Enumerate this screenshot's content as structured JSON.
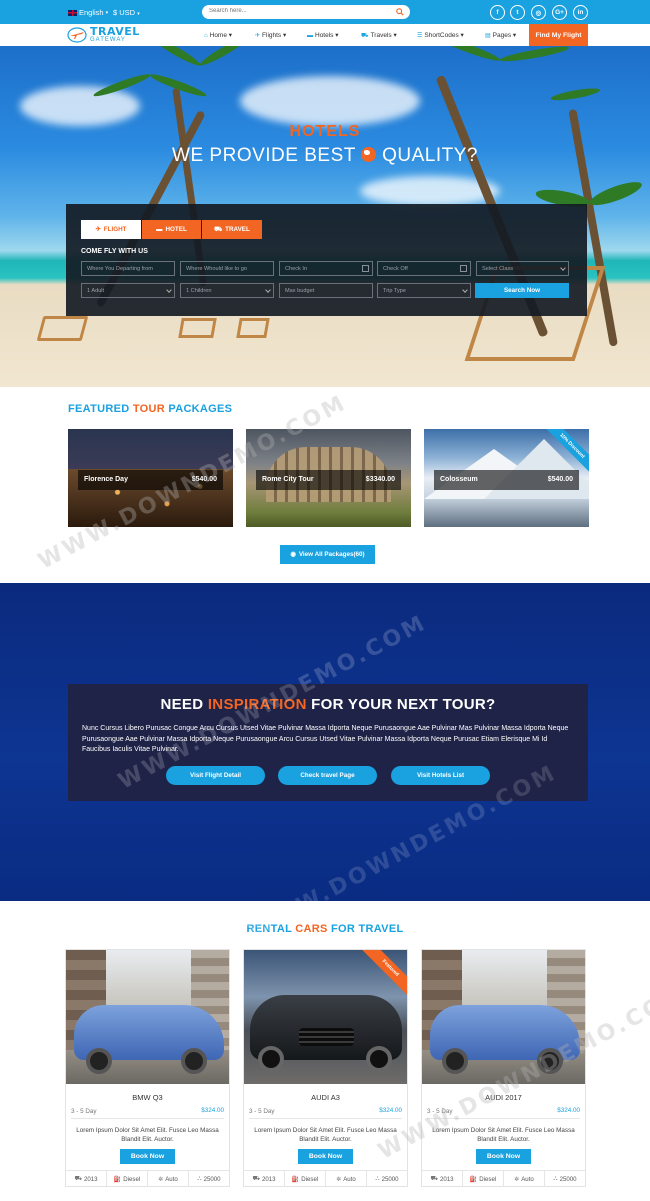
{
  "topbar": {
    "language": "English",
    "currency": "$ USD",
    "search_placeholder": "Search here...",
    "social": [
      "f",
      "t",
      "◎",
      "G+",
      "in"
    ]
  },
  "logo": {
    "line1": "TRAVEL",
    "line2": "GATEWAY"
  },
  "nav": {
    "items": [
      {
        "label": "Home",
        "icon": "home-icon"
      },
      {
        "label": "Flights",
        "icon": "plane-icon"
      },
      {
        "label": "Hotels",
        "icon": "bed-icon"
      },
      {
        "label": "Travels",
        "icon": "car-icon"
      },
      {
        "label": "ShortCodes",
        "icon": "list-icon"
      },
      {
        "label": "Pages",
        "icon": "file-icon"
      }
    ],
    "cta": "Find My Flight"
  },
  "hero": {
    "title_small": "HOTELS",
    "title_pre": "WE PROVIDE BEST",
    "title_post": "QUALITY?"
  },
  "booking": {
    "tabs": [
      "FLIGHT",
      "HOTEL",
      "TRAVEL"
    ],
    "label": "COME FLY WITH US",
    "row1": [
      "Where You Departing from",
      "Where Whould like to go",
      "Check In",
      "Check Off",
      "Select Class"
    ],
    "row2": [
      "1 Adult",
      "1 Children",
      "Max budget",
      "Trip Type"
    ],
    "search_button": "Search Now"
  },
  "featured": {
    "title_a": "FEATURED",
    "title_b": "TOUR",
    "title_c": "PACKAGES",
    "tours": [
      {
        "name": "Florence Day",
        "price": "$540.00"
      },
      {
        "name": "Rome City Tour",
        "price": "$3340.00"
      },
      {
        "name": "Colosseum",
        "price": "$540.00",
        "ribbon": "10% Discount"
      }
    ],
    "view_all": "View All Packages(60)"
  },
  "inspiration": {
    "title_a": "NEED",
    "title_b": "INSPIRATION",
    "title_c": "FOR YOUR NEXT TOUR?",
    "text": "Nunc Cursus Libero Purusac Congue Arcu Cursus Utsed Vitae Pulvinar Massa Idporta Neque Purusaongue Aae Pulvinar Mas Pulvinar Massa Idporta Neque Purusaongue Aae Pulvinar Massa Idporta Neque Purusaongue Arcu Cursus Utsed Vitae Pulvinar Massa Idporta Neque Purusac Etiam Elerisque Mi Id Faucibus Iaculis Vitae Pulvinar.",
    "buttons": [
      "Visit Flight Detail",
      "Check travel Page",
      "Visit Hotels List"
    ]
  },
  "cars": {
    "title_a": "RENTAL",
    "title_b": "CARS",
    "title_c": "FOR TRAVEL",
    "items": [
      {
        "name": "BMW Q3",
        "days": "3 - 5 Day",
        "price": "$324.00",
        "desc": "Lorem Ipsum Dolor Sit Amet Elit. Fusce Leo Massa Blandit Elit. Auctor.",
        "book": "Book Now",
        "specs": [
          "2013",
          "Diesel",
          "Auto",
          "25000"
        ]
      },
      {
        "name": "AUDI A3",
        "days": "3 - 5 Day",
        "price": "$324.00",
        "desc": "Lorem Ipsum Dolor Sit Amet Elit. Fusce Leo Massa Blandit Elit. Auctor.",
        "book": "Book Now",
        "specs": [
          "2013",
          "Diesel",
          "Auto",
          "25000"
        ],
        "ribbon": "Featured"
      },
      {
        "name": "AUDI 2017",
        "days": "3 - 5 Day",
        "price": "$324.00",
        "desc": "Lorem Ipsum Dolor Sit Amet Elit. Fusce Leo Massa Blandit Elit. Auctor.",
        "book": "Book Now",
        "specs": [
          "2013",
          "Diesel",
          "Auto",
          "25000"
        ]
      }
    ]
  },
  "watermark": "WWW.DOWNDEMO.COM",
  "colors": {
    "primary": "#1aa1df",
    "accent": "#f26522",
    "navy": "#0d3592",
    "dark_box": "#1f2347"
  }
}
